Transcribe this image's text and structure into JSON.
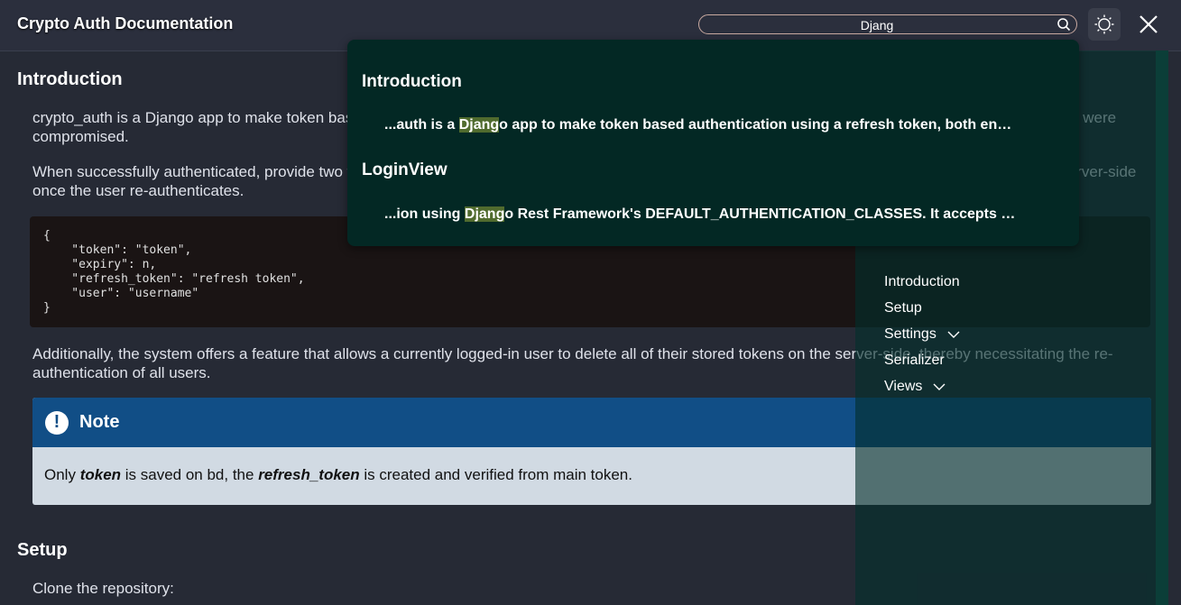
{
  "header": {
    "title": "Crypto Auth Documentation",
    "search_value": "Djang",
    "icons": {
      "search": "search-icon",
      "theme": "theme-toggle-icon",
      "close": "close-icon"
    }
  },
  "main": {
    "intro_heading": "Introduction",
    "intro_p1": "crypto_auth is a Django app to make token based authentication using a refresh token, both encrypted, making them useless for an attacker even if the db were compromised.",
    "intro_p2": "When successfully authenticated, provide two tokens: the access token and the refresh token. The previous tokens are automatically removed from the server-side once the user re-authenticates.",
    "code_lines": [
      "{",
      "    \"token\": \"token\",",
      "    \"expiry\": n,",
      "    \"refresh_token\": \"refresh token\",",
      "    \"user\": \"username\"",
      "}"
    ],
    "intro_p3": "Additionally, the system offers a feature that allows a currently logged-in user to delete all of their stored tokens on the server-side, thereby necessitating the re-authentication of all users.",
    "note": {
      "icon": "!",
      "title": "Note",
      "body_pre": "Only ",
      "body_em1": "token",
      "body_mid": " is saved on bd, the ",
      "body_em2": "refresh_token",
      "body_post": " is created and verified from main token."
    },
    "setup_heading": "Setup",
    "setup_p1": "Clone the repository:"
  },
  "sidebar": {
    "items": [
      {
        "label": "Introduction",
        "expandable": false
      },
      {
        "label": "Setup",
        "expandable": false
      },
      {
        "label": "Settings",
        "expandable": true
      },
      {
        "label": "Serializer",
        "expandable": false
      },
      {
        "label": "Views",
        "expandable": true
      }
    ]
  },
  "search_results": [
    {
      "section": "Introduction",
      "pre": "...auth is a ",
      "match": "Djang",
      "post": "o app to make token based authentication using a refresh token, both en…"
    },
    {
      "section": "LoginView",
      "pre": "...ion using ",
      "match": "Djang",
      "post": "o Rest Framework's DEFAULT_AUTHENTICATION_CLASSES. It accepts …"
    }
  ],
  "colors": {
    "accent": "#114e86",
    "highlight": "#506b2e",
    "dropdown_bg": "#032824"
  }
}
